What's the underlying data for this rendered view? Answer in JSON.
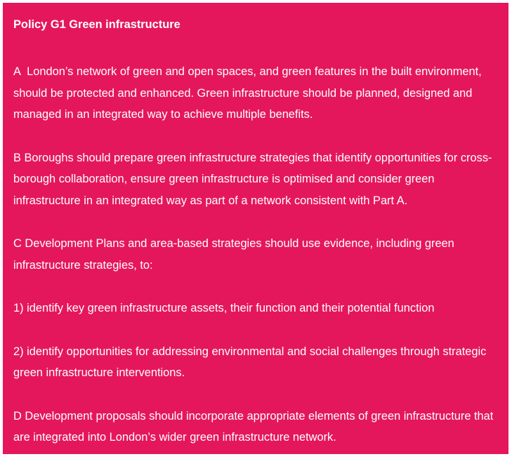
{
  "policy": {
    "title": "Policy G1 Green infrastructure",
    "paragraphs": [
      "A  London’s network of green and open spaces, and green features in the built environment, should be protected and enhanced. Green infrastructure should be planned, designed and managed in an integrated way to achieve multiple benefits.",
      "B Boroughs should prepare green infrastructure strategies that identify opportunities for cross-borough collaboration, ensure green infrastructure is optimised and consider green infrastructure in an integrated way as part of a network consistent with Part A.",
      "C Development Plans and area-based strategies should use evidence, including green infrastructure strategies, to:",
      "1) identify key green infrastructure assets, their function and their potential function",
      "2) identify opportunities for addressing environmental and social challenges through strategic green infrastructure interventions.",
      "D Development proposals should incorporate appropriate elements of green infrastructure that are integrated into London’s wider green infrastructure network."
    ]
  }
}
